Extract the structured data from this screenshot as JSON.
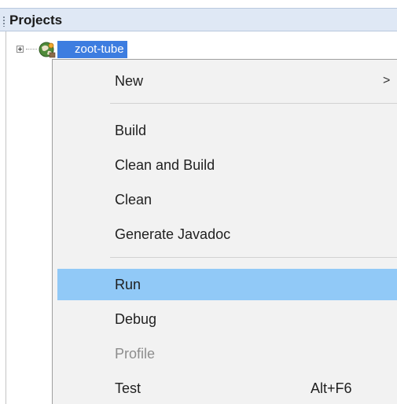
{
  "panel": {
    "title": "Projects"
  },
  "tree": {
    "project_name": "zoot-tube"
  },
  "context_menu": {
    "items": [
      {
        "label": "New",
        "has_submenu": true,
        "submenu_arrow": ">"
      },
      {
        "label": "Build"
      },
      {
        "label": "Clean and Build"
      },
      {
        "label": "Clean"
      },
      {
        "label": "Generate Javadoc"
      },
      {
        "label": "Run",
        "highlighted": true
      },
      {
        "label": "Debug"
      },
      {
        "label": "Profile",
        "disabled": true
      },
      {
        "label": "Test",
        "shortcut": "Alt+F6"
      }
    ]
  },
  "colors": {
    "header_bg": "#dfe8f5",
    "selection_bg": "#3d7de0",
    "menu_bg": "#f2f2f2",
    "menu_highlight": "#91c9f7",
    "disabled_text": "#8d8d8d"
  },
  "icons": {
    "expand": "plus-box-icon",
    "project": "project-globe-icon",
    "submenu": "chevron-right-icon"
  }
}
